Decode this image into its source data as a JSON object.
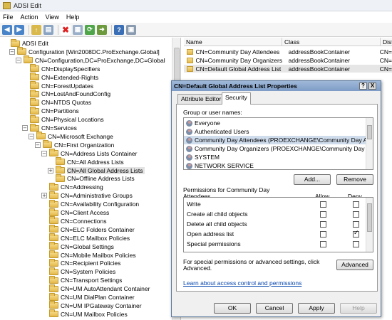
{
  "window": {
    "title": "ADSI Edit"
  },
  "menu": [
    "File",
    "Action",
    "View",
    "Help"
  ],
  "toolbar": [
    "back-icon",
    "forward-icon",
    "up-folder-icon",
    "show-hide-tree-icon",
    "delete-icon",
    "properties-icon",
    "refresh-icon",
    "export-icon",
    "help-icon",
    "console-icon"
  ],
  "tree": [
    {
      "label": "ADSI Edit",
      "level": 0,
      "expander": ""
    },
    {
      "label": "Configuration [Win2008DC.ProExchange.Global]",
      "level": 1,
      "expander": "−"
    },
    {
      "label": "CN=Configuration,DC=ProExchange,DC=Global",
      "level": 2,
      "expander": "−"
    },
    {
      "label": "CN=DisplaySpecifiers",
      "level": 3,
      "expander": ""
    },
    {
      "label": "CN=Extended-Rights",
      "level": 3,
      "expander": ""
    },
    {
      "label": "CN=ForestUpdates",
      "level": 3,
      "expander": ""
    },
    {
      "label": "CN=LostAndFoundConfig",
      "level": 3,
      "expander": ""
    },
    {
      "label": "CN=NTDS Quotas",
      "level": 3,
      "expander": ""
    },
    {
      "label": "CN=Partitions",
      "level": 3,
      "expander": ""
    },
    {
      "label": "CN=Physical Locations",
      "level": 3,
      "expander": ""
    },
    {
      "label": "CN=Services",
      "level": 3,
      "expander": "−"
    },
    {
      "label": "CN=Microsoft Exchange",
      "level": 4,
      "expander": "−"
    },
    {
      "label": "CN=First Organization",
      "level": 5,
      "expander": "−"
    },
    {
      "label": "CN=Address Lists Container",
      "level": 6,
      "expander": "−"
    },
    {
      "label": "CN=All Address Lists",
      "level": 7,
      "expander": ""
    },
    {
      "label": "CN=All Global Address Lists",
      "level": 7,
      "expander": "+",
      "selected": true
    },
    {
      "label": "CN=Offline Address Lists",
      "level": 7,
      "expander": ""
    },
    {
      "label": "CN=Addressing",
      "level": 6,
      "expander": ""
    },
    {
      "label": "CN=Administrative Groups",
      "level": 6,
      "expander": "+"
    },
    {
      "label": "CN=Availability Configuration",
      "level": 6,
      "expander": ""
    },
    {
      "label": "CN=Client Access",
      "level": 6,
      "expander": ""
    },
    {
      "label": "CN=Connections",
      "level": 6,
      "expander": ""
    },
    {
      "label": "CN=ELC Folders Container",
      "level": 6,
      "expander": ""
    },
    {
      "label": "CN=ELC Mailbox Policies",
      "level": 6,
      "expander": ""
    },
    {
      "label": "CN=Global Settings",
      "level": 6,
      "expander": ""
    },
    {
      "label": "CN=Mobile Mailbox Policies",
      "level": 6,
      "expander": ""
    },
    {
      "label": "CN=Recipient Policies",
      "level": 6,
      "expander": ""
    },
    {
      "label": "CN=System Policies",
      "level": 6,
      "expander": ""
    },
    {
      "label": "CN=Transport Settings",
      "level": 6,
      "expander": ""
    },
    {
      "label": "CN=UM AutoAttendant Container",
      "level": 6,
      "expander": ""
    },
    {
      "label": "CN=UM DialPlan Container",
      "level": 6,
      "expander": ""
    },
    {
      "label": "CN=UM IPGateway Container",
      "level": 6,
      "expander": ""
    },
    {
      "label": "CN=UM Mailbox Policies",
      "level": 6,
      "expander": ""
    }
  ],
  "list": {
    "headers": [
      "Name",
      "Class",
      "Dist"
    ],
    "rows": [
      {
        "name": "CN=Community Day Attendees",
        "class": "addressBookContainer",
        "dist": "CN="
      },
      {
        "name": "CN=Community Day Organizers",
        "class": "addressBookContainer",
        "dist": "CN="
      },
      {
        "name": "CN=Default Global Address List",
        "class": "addressBookContainer",
        "dist": "CN="
      }
    ]
  },
  "dialog": {
    "title": "CN=Default Global Address List Properties",
    "help_button": "?",
    "close_button": "X",
    "tabs": [
      "Attribute Editor",
      "Security"
    ],
    "group_label": "Group or user names:",
    "users": [
      "Everyone",
      "Authenticated Users",
      "Community Day Attendees (PROEXCHANGE\\Community Day At...",
      "Community Day Organizers (PROEXCHANGE\\Community Day O...",
      "SYSTEM",
      "NETWORK SERVICE"
    ],
    "add_label": "Add...",
    "remove_label": "Remove",
    "perm_label_line1": "Permissions for Community Day",
    "perm_label_line2": "Attendees",
    "allow_label": "Allow",
    "deny_label": "Deny",
    "permissions": [
      {
        "name": "Write",
        "allow": false,
        "deny": false
      },
      {
        "name": "Create all child objects",
        "allow": false,
        "deny": false
      },
      {
        "name": "Delete all child objects",
        "allow": false,
        "deny": false
      },
      {
        "name": "Open address list",
        "allow": false,
        "deny": true
      },
      {
        "name": "Special permissions",
        "allow": false,
        "deny": false
      }
    ],
    "special_text_line1": "For special permissions or advanced settings, click",
    "special_text_line2": "Advanced.",
    "advanced_label": "Advanced",
    "learn_link": "Learn about access control and permissions",
    "ok_label": "OK",
    "cancel_label": "Cancel",
    "apply_label": "Apply",
    "help_label": "Help"
  }
}
